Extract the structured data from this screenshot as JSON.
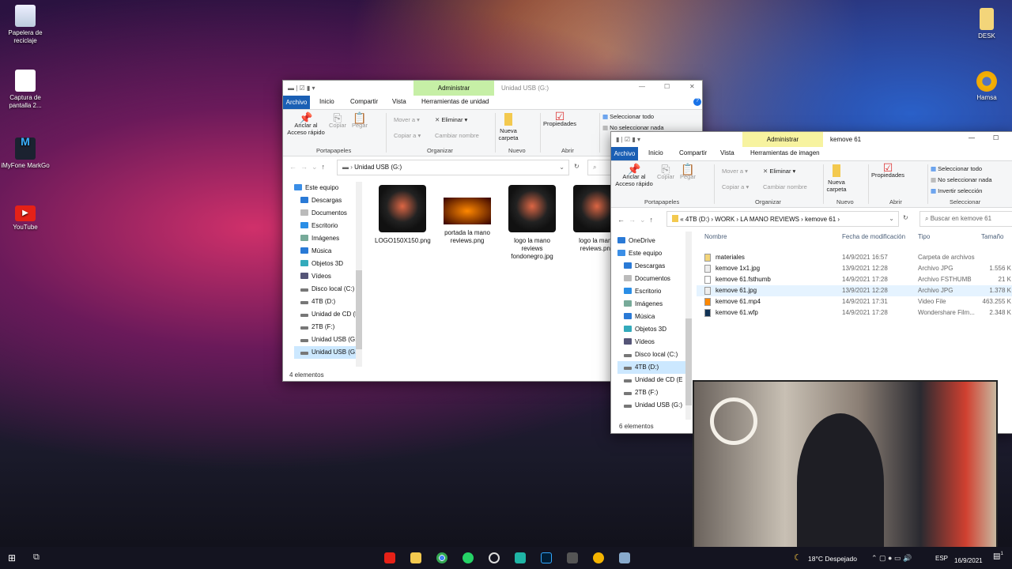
{
  "desktop": {
    "left_icons": [
      "Papelera de reciclaje",
      "Captura de pantalla 2...",
      "iMyFone MarkGo",
      "YouTube"
    ],
    "right_icons": [
      "DESK",
      "Hamsa"
    ]
  },
  "ribbon": {
    "archivo": "Archivo",
    "inicio": "Inicio",
    "compartir": "Compartir",
    "vista": "Vista",
    "administrar": "Administrar",
    "anclar": "Anclar al Acceso rápido",
    "copiar": "Copiar",
    "pegar": "Pegar",
    "mover": "Mover a",
    "copiar_a": "Copiar a",
    "eliminar": "Eliminar",
    "cambiar": "Cambiar nombre",
    "nueva": "Nueva carpeta",
    "propiedades": "Propiedades",
    "g_portapapeles": "Portapapeles",
    "g_organizar": "Organizar",
    "g_nuevo": "Nuevo",
    "g_abrir": "Abrir",
    "g_seleccionar": "Seleccionar",
    "sel_todo": "Seleccionar todo",
    "sel_nada": "No seleccionar nada",
    "invertir": "Invertir selección"
  },
  "win_usb": {
    "title": "Unidad USB (G:)",
    "context_tab": "Herramientas de unidad",
    "address": "Unidad USB (G:)",
    "nav": [
      "Este equipo",
      "Descargas",
      "Documentos",
      "Escritorio",
      "Imágenes",
      "Música",
      "Objetos 3D",
      "Vídeos",
      "Disco local (C:)",
      "4TB (D:)",
      "Unidad de CD (E",
      "2TB (F:)",
      "Unidad USB (G:)",
      "Unidad USB (G:)"
    ],
    "files": [
      "LOGO150X150.png",
      "portada la mano reviews.png",
      "logo la mano reviews fondonegro.jpg",
      "logo la mano reviews.png"
    ],
    "status": "4 elementos"
  },
  "win_kemove": {
    "title": "kemove 61",
    "context_tab": "Herramientas de imagen",
    "breadcrumb": [
      "«",
      "4TB (D:)",
      "WORK",
      "LA MANO REVIEWS",
      "kemove 61"
    ],
    "search_placeholder": "Buscar en kemove 61",
    "nav": [
      "OneDrive",
      "Este equipo",
      "Descargas",
      "Documentos",
      "Escritorio",
      "Imágenes",
      "Música",
      "Objetos 3D",
      "Vídeos",
      "Disco local (C:)",
      "4TB (D:)",
      "Unidad de CD (E",
      "2TB (F:)",
      "Unidad USB (G:)"
    ],
    "columns": [
      "Nombre",
      "Fecha de modificación",
      "Tipo",
      "Tamaño"
    ],
    "files": [
      {
        "name": "materiales",
        "date": "14/9/2021 16:57",
        "type": "Carpeta de archivos",
        "size": ""
      },
      {
        "name": "kemove 1x1.jpg",
        "date": "13/9/2021 12:28",
        "type": "Archivo JPG",
        "size": "1.556 K"
      },
      {
        "name": "kemove 61.fsthumb",
        "date": "14/9/2021 17:28",
        "type": "Archivo FSTHUMB",
        "size": "21 K"
      },
      {
        "name": "kemove 61.jpg",
        "date": "13/9/2021 12:28",
        "type": "Archivo JPG",
        "size": "1.378 K"
      },
      {
        "name": "kemove 61.mp4",
        "date": "14/9/2021 17:31",
        "type": "Video File",
        "size": "463.255 K"
      },
      {
        "name": "kemove 61.wfp",
        "date": "14/9/2021 17:28",
        "type": "Wondershare Film...",
        "size": "2.348 K"
      }
    ],
    "status": "6 elementos"
  },
  "tray": {
    "weather": "18°C Despejado",
    "lang": "ESP",
    "date": "16/9/2021",
    "notifications": "1"
  }
}
